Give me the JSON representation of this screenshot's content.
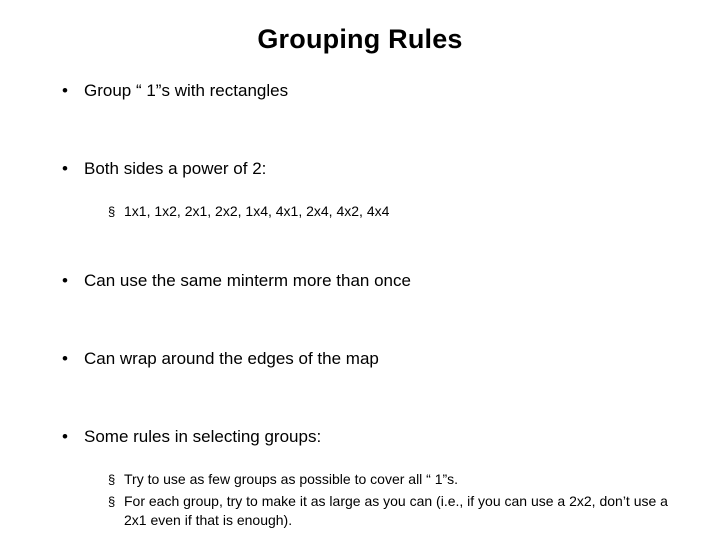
{
  "slide": {
    "title": "Grouping Rules",
    "bullet_marker_level1": "•",
    "bullet_marker_level2": "§",
    "items": [
      {
        "level": 1,
        "text": "Group “ 1”s with rectangles"
      },
      {
        "level": 1,
        "text": "Both sides a power of 2:"
      },
      {
        "level": 2,
        "text": "1x1, 1x2, 2x1, 2x2, 1x4, 4x1, 2x4, 4x2, 4x4"
      },
      {
        "level": 1,
        "text": "Can use the same minterm more than once"
      },
      {
        "level": 1,
        "text": "Can wrap around the edges of the map"
      },
      {
        "level": 1,
        "text": "Some rules in selecting groups:"
      },
      {
        "level": 2,
        "text": "Try to use as few groups as possible to cover all “ 1”s."
      },
      {
        "level": 2,
        "text": "For each group, try to make it as large as you can (i.e., if you can use a 2x2, don’t use a 2x1 even if that is enough)."
      }
    ]
  }
}
